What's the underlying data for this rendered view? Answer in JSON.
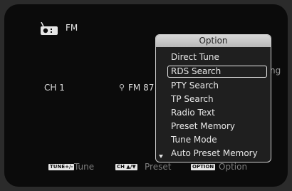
{
  "source": {
    "label": "FM",
    "icon": "radio-tuner-icon"
  },
  "status": {
    "channel": "CH 1",
    "frequency": "FM 87",
    "frequency_icon": "antenna-icon",
    "partial_text": "ng"
  },
  "hints": [
    {
      "key": "TUNE+/-",
      "label": "Tune"
    },
    {
      "key": "CH ▲/▼",
      "label": "Preset"
    },
    {
      "key": "OPTION",
      "label": "Option"
    }
  ],
  "menu": {
    "title": "Option",
    "items": [
      {
        "label": "Direct Tune"
      },
      {
        "label": "RDS Search"
      },
      {
        "label": "PTY Search"
      },
      {
        "label": "TP Search"
      },
      {
        "label": "Radio Text"
      },
      {
        "label": "Preset Memory"
      },
      {
        "label": "Tune Mode"
      },
      {
        "label": "Auto Preset Memory"
      }
    ],
    "selected": "RDS Search"
  }
}
